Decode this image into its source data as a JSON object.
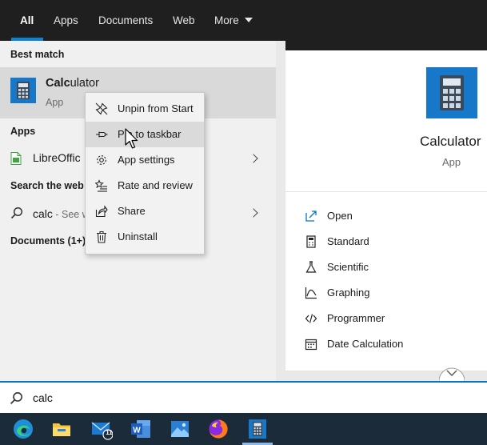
{
  "tabs": [
    {
      "label": "All",
      "active": true
    },
    {
      "label": "Apps"
    },
    {
      "label": "Documents"
    },
    {
      "label": "Web"
    },
    {
      "label": "More"
    }
  ],
  "left": {
    "best_match_header": "Best match",
    "best_match": {
      "title_bold": "Calc",
      "title_rest": "ulator",
      "subtitle": "App"
    },
    "apps_header": "Apps",
    "apps_item": "LibreOffic",
    "web_header": "Search the web",
    "web_query": "calc",
    "web_suffix": " - See w",
    "documents_header": "Documents (1+)"
  },
  "context_menu": {
    "items": [
      {
        "label": "Unpin from Start",
        "icon": "unpin-icon"
      },
      {
        "label": "Pin to taskbar",
        "icon": "pin-icon",
        "hover": true
      },
      {
        "label": "App settings",
        "icon": "gear-icon"
      },
      {
        "label": "Rate and review",
        "icon": "star-review-icon"
      },
      {
        "label": "Share",
        "icon": "share-icon"
      },
      {
        "label": "Uninstall",
        "icon": "trash-icon"
      }
    ]
  },
  "right": {
    "app_title": "Calculator",
    "app_subtitle": "App",
    "actions": [
      {
        "label": "Open",
        "icon": "open-icon"
      },
      {
        "label": "Standard",
        "icon": "standard-calculator-icon"
      },
      {
        "label": "Scientific",
        "icon": "flask-icon"
      },
      {
        "label": "Graphing",
        "icon": "graph-icon"
      },
      {
        "label": "Programmer",
        "icon": "code-icon"
      },
      {
        "label": "Date Calculation",
        "icon": "calendar-icon"
      }
    ]
  },
  "search": {
    "value": "calc"
  },
  "taskbar": {
    "mail_badge": "11"
  },
  "colors": {
    "accent": "#0a84d6",
    "calc_icon_bg": "#1778c9",
    "taskbar": "#1c2b3a"
  }
}
